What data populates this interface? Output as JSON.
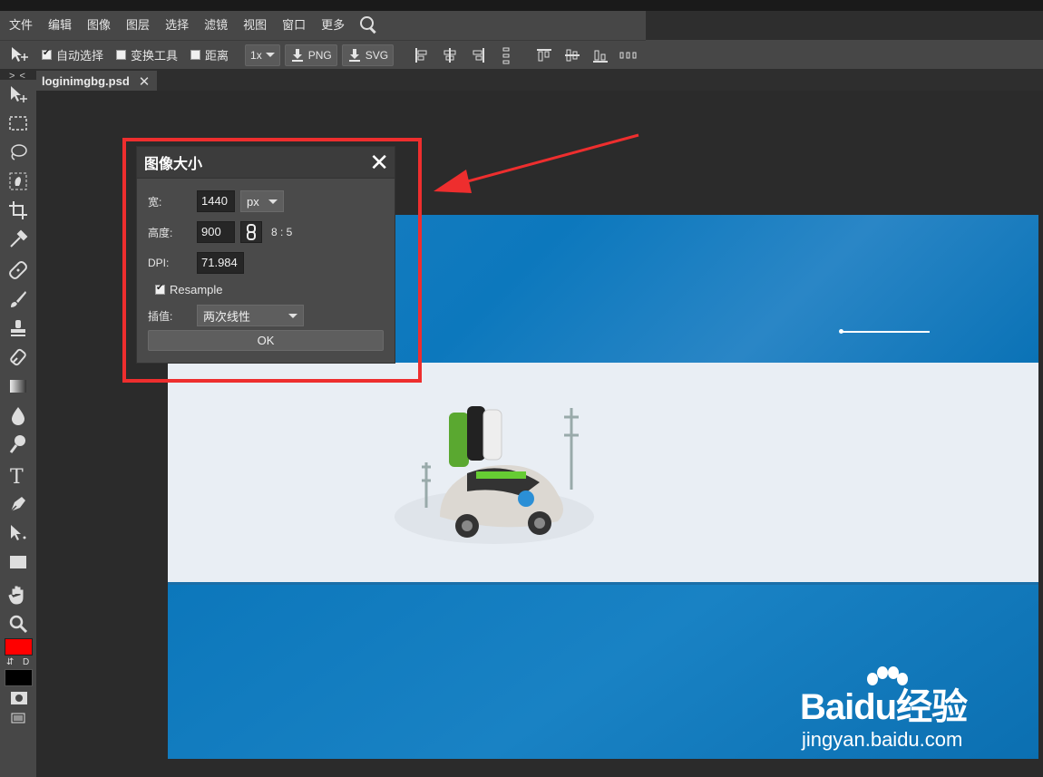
{
  "menu": {
    "items": [
      "文件",
      "编辑",
      "图像",
      "图层",
      "选择",
      "滤镜",
      "视图",
      "窗口",
      "更多"
    ],
    "search_icon": "search-icon"
  },
  "options": {
    "auto_select_label": "自动选择",
    "auto_select_checked": true,
    "transform_label": "变换工具",
    "transform_checked": false,
    "distance_label": "距离",
    "distance_checked": false,
    "zoom_value": "1x",
    "png_label": "PNG",
    "svg_label": "SVG"
  },
  "tabs": {
    "collapse_label": "> <",
    "doc_name": "loginimgbg.psd",
    "close_symbol": "✕"
  },
  "toolbar": {
    "fg_color": "#ff0000",
    "bg_color": "#000000",
    "swap_label": "⇵",
    "default_label": "D"
  },
  "dialog": {
    "title": "图像大小",
    "close_symbol": "✕",
    "width_label": "宽:",
    "width_value": "1440",
    "unit_value": "px",
    "height_label": "高度:",
    "height_value": "900",
    "ratio_text": "8 : 5",
    "dpi_label": "DPI:",
    "dpi_value": "71.984",
    "resample_label": "Resample",
    "resample_checked": true,
    "interp_label": "插值:",
    "interp_value": "两次线性",
    "ok_label": "OK"
  },
  "watermark": {
    "main": "Baidu经验",
    "sub": "jingyan.baidu.com"
  },
  "colors": {
    "highlight_red": "#ee2e2e",
    "canvas_blue": "#0c78bd"
  }
}
